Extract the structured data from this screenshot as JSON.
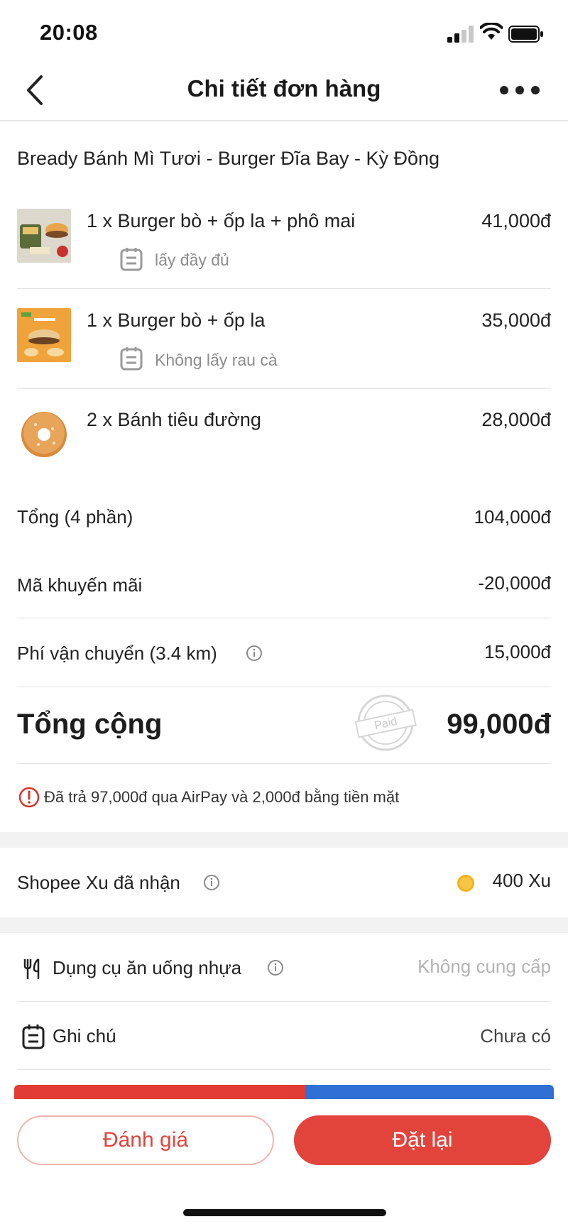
{
  "status_bar": {
    "time": "20:08"
  },
  "header": {
    "title": "Chi tiết đơn hàng"
  },
  "store": {
    "name": "Bready Bánh Mì Tươi - Burger Đĩa Bay - Kỳ Đồng"
  },
  "items": [
    {
      "name": "1 x Burger bò + ốp la + phô mai",
      "price": "41,000đ",
      "note": "lấy đầy đủ"
    },
    {
      "name": "1 x Burger bò + ốp la",
      "price": "35,000đ",
      "note": "Không lấy rau cà"
    },
    {
      "name": "2 x Bánh tiêu đường",
      "price": "28,000đ",
      "note": ""
    }
  ],
  "summary": {
    "subtotal_label": "Tổng (4 phần)",
    "subtotal_value": "104,000đ",
    "promo_label": "Mã khuyến mãi",
    "promo_value": "-20,000đ",
    "shipping_label": "Phí vận chuyển (3.4 km)",
    "shipping_value": "15,000đ",
    "total_label": "Tổng cộng",
    "total_value": "99,000đ",
    "paid_stamp": "Paid",
    "payment_note": "Đã trả 97,000đ qua AirPay và 2,000đ bằng tiền mặt"
  },
  "coins": {
    "label": "Shopee Xu đã nhận",
    "value": "400 Xu"
  },
  "extras": {
    "utensils_label": "Dụng cụ ăn uống nhựa",
    "utensils_value": "Không cung cấp",
    "note_label": "Ghi chú",
    "note_value": "Chưa có"
  },
  "actions": {
    "review_label": "Đánh giá",
    "reorder_label": "Đặt lại"
  },
  "colors": {
    "accent": "#e2433b",
    "muted": "#8c8c8c",
    "coin": "#f5b21f"
  }
}
